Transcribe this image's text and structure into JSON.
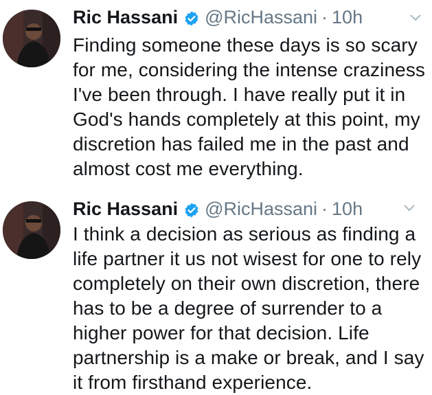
{
  "tweets": [
    {
      "name": "Ric Hassani",
      "handle": "@RicHassani",
      "separator": "·",
      "time": "10h",
      "lines": [
        "Finding someone these days is so scary",
        "for me, considering the intense craziness",
        "I've been through. I have really put it in",
        "God's hands completely at this point, my",
        "discretion has failed me in the past and",
        "almost cost me everything."
      ]
    },
    {
      "name": "Ric Hassani",
      "handle": "@RicHassani",
      "separator": "·",
      "time": "10h",
      "lines": [
        "I think a decision as serious as finding a",
        "life partner it us not wisest for one to rely",
        "completely on their own discretion, there",
        "has to be a degree of surrender to a",
        "higher power for that decision. Life",
        "partnership is a make or break, and I say",
        "it from firsthand experience."
      ]
    }
  ],
  "icons": {
    "verified": "verified-badge-icon",
    "chevron": "chevron-down-icon"
  },
  "colors": {
    "text": "#14171a",
    "secondary": "#657786",
    "verified": "#1da1f2"
  }
}
